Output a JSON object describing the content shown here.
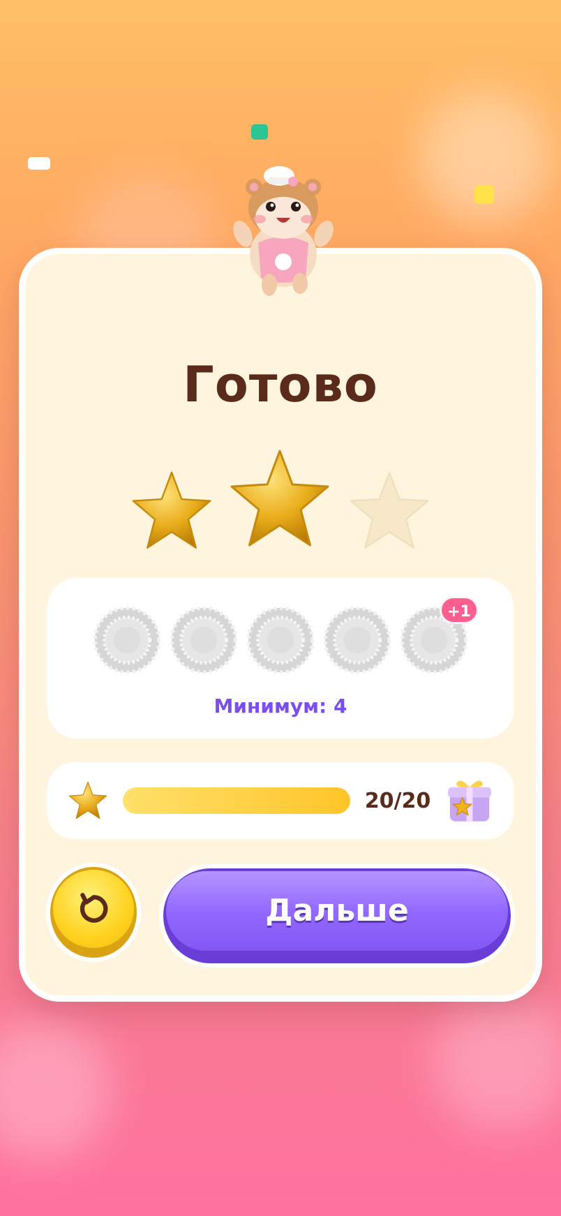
{
  "result": {
    "title": "Готово",
    "stars_earned": 2,
    "stars_total": 3
  },
  "cups": {
    "count": 5,
    "bonus_badge": "+1",
    "minimum_label": "Минимум: 4"
  },
  "progress": {
    "text": "20/20",
    "current": 20,
    "max": 20
  },
  "buttons": {
    "next_label": "Дальше",
    "retry_icon": "retry-icon"
  },
  "colors": {
    "title": "#5a2a1a",
    "minimum": "#7b4ef0",
    "next_button": "#9269ff",
    "retry_button": "#ffd21f",
    "badge": "#ff5f8f",
    "star_gold": "#e9ad1b"
  }
}
